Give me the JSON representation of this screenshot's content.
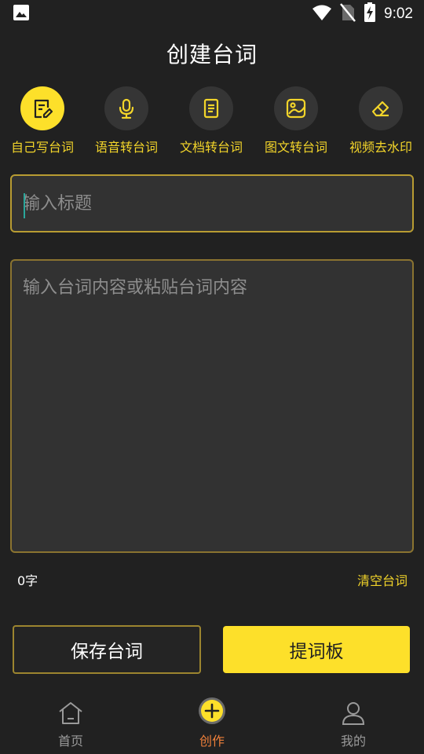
{
  "status_bar": {
    "time": "9:02",
    "icons": [
      "image-icon",
      "wifi-icon",
      "no-sim-icon",
      "battery-charging-icon"
    ]
  },
  "page": {
    "title": "创建台词"
  },
  "tools": [
    {
      "label": "自己写台词",
      "icon": "edit-document-icon",
      "active": true
    },
    {
      "label": "语音转台词",
      "icon": "microphone-icon",
      "active": false
    },
    {
      "label": "文档转台词",
      "icon": "document-icon",
      "active": false
    },
    {
      "label": "图文转台词",
      "icon": "image-icon",
      "active": false
    },
    {
      "label": "视频去水印",
      "icon": "eraser-icon",
      "active": false
    }
  ],
  "form": {
    "title_placeholder": "输入标题",
    "title_value": "",
    "content_placeholder": "输入台词内容或粘贴台词内容",
    "content_value": "",
    "word_count": "0字",
    "clear_label": "清空台词"
  },
  "actions": {
    "save_label": "保存台词",
    "prompter_label": "提词板"
  },
  "bottom_nav": [
    {
      "label": "首页",
      "icon": "home-icon",
      "active": false
    },
    {
      "label": "创作",
      "icon": "add-circle-icon",
      "active": true
    },
    {
      "label": "我的",
      "icon": "user-icon",
      "active": false
    }
  ],
  "colors": {
    "background": "#212121",
    "accent": "#fde02a",
    "accent_text": "#f3d52a",
    "active_nav": "#f0803a"
  }
}
